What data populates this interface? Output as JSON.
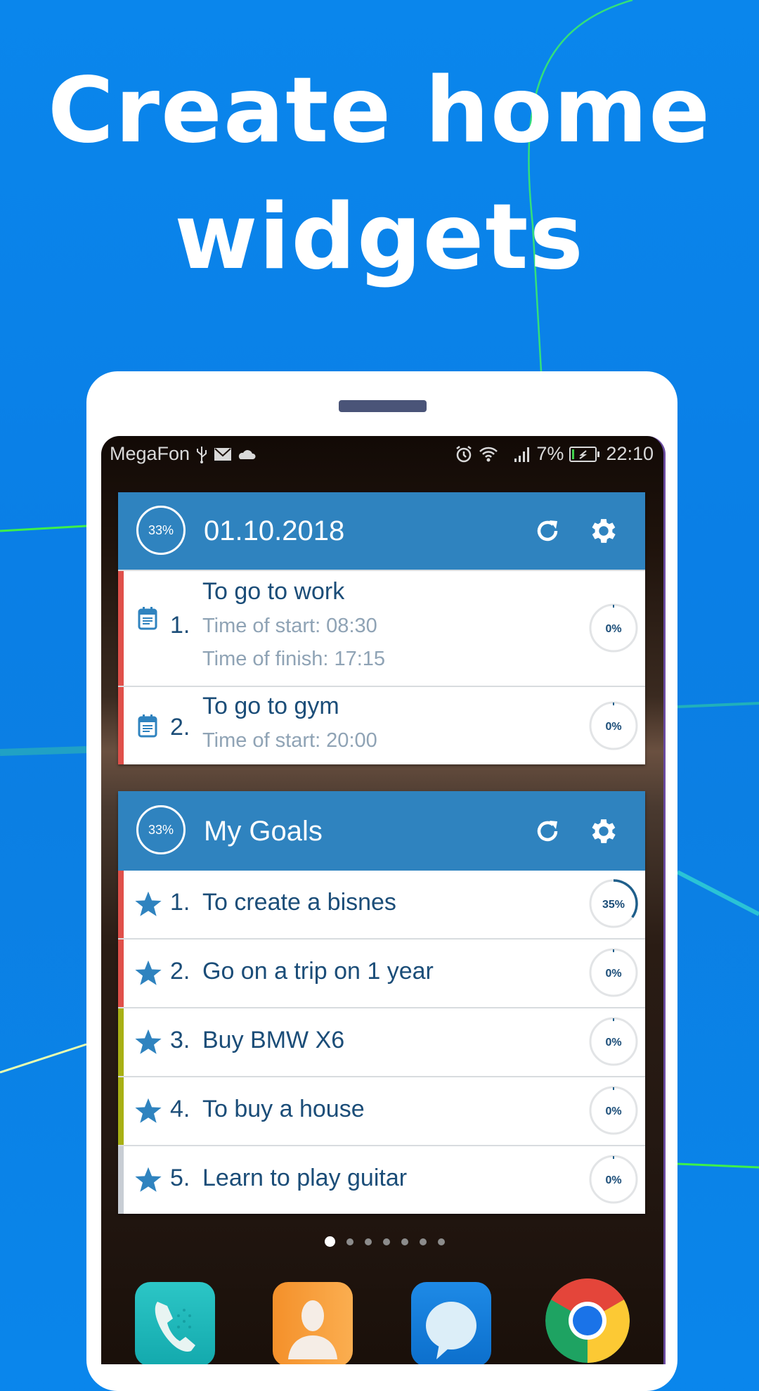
{
  "headline": {
    "line1": "Create home",
    "line2": "widgets"
  },
  "colors": {
    "background": "#0a80e6",
    "widget_header": "#2f83bf",
    "text_primary": "#1b4d78",
    "text_secondary": "#8fa3b5",
    "accent_red": "#e0504a",
    "accent_olive": "#a8b014",
    "accent_gray": "#c8cdd4",
    "progress_arc": "#1f5f8b"
  },
  "statusbar": {
    "carrier": "MegaFon",
    "left_icons": [
      "usb-icon",
      "mail-icon",
      "cloud-icon"
    ],
    "right_icons": [
      "alarm-icon",
      "wifi-icon",
      "signal-icon"
    ],
    "battery": "7%",
    "time": "22:10"
  },
  "widgets": [
    {
      "progress_label": "33%",
      "title": "01.10.2018",
      "refresh_icon": "refresh-icon",
      "settings_icon": "gear-icon",
      "items": [
        {
          "number": "1.",
          "title": "To go to work",
          "subtitles": [
            "Time of start: 08:30",
            "Time of finish: 17:15"
          ],
          "progress": 0,
          "progress_label": "0%",
          "accent": "red",
          "icon": "calendar-icon"
        },
        {
          "number": "2.",
          "title": "To go to gym",
          "subtitles": [
            "Time of start: 20:00"
          ],
          "progress": 0,
          "progress_label": "0%",
          "accent": "red",
          "icon": "calendar-icon"
        }
      ]
    },
    {
      "progress_label": "33%",
      "title": "My Goals",
      "refresh_icon": "refresh-icon",
      "settings_icon": "gear-icon",
      "items": [
        {
          "number": "1.",
          "title": "To create a bisnes",
          "progress": 35,
          "progress_label": "35%",
          "accent": "red",
          "icon": "star-icon"
        },
        {
          "number": "2.",
          "title": "Go on a trip on 1 year",
          "progress": 0,
          "progress_label": "0%",
          "accent": "red",
          "icon": "star-icon"
        },
        {
          "number": "3.",
          "title": "Buy BMW X6",
          "progress": 0,
          "progress_label": "0%",
          "accent": "olive",
          "icon": "star-icon"
        },
        {
          "number": "4.",
          "title": "To buy a house",
          "progress": 0,
          "progress_label": "0%",
          "accent": "olive",
          "icon": "star-icon"
        },
        {
          "number": "5.",
          "title": "Learn to play guitar",
          "progress": 0,
          "progress_label": "0%",
          "accent": "gray",
          "icon": "star-icon"
        }
      ]
    }
  ],
  "pager": {
    "count": 7,
    "active_index": 0
  },
  "dock": [
    {
      "name": "phone",
      "icon": "phone-icon"
    },
    {
      "name": "contacts",
      "icon": "contacts-icon"
    },
    {
      "name": "messages",
      "icon": "messages-icon"
    },
    {
      "name": "chrome",
      "icon": "chrome-icon"
    }
  ]
}
